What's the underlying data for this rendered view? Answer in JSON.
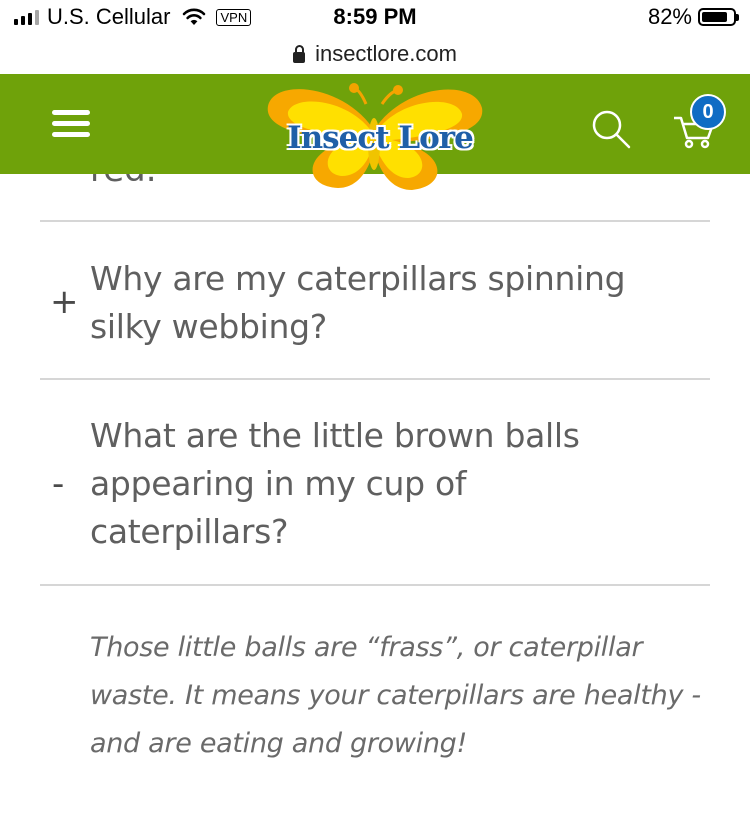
{
  "status_bar": {
    "carrier": "U.S. Cellular",
    "vpn": "VPN",
    "time": "8:59 PM",
    "battery_percent": "82%",
    "battery_level": 0.82
  },
  "browser": {
    "url": "insectlore.com"
  },
  "header": {
    "logo_text": "Insect Lore",
    "cart_count": "0",
    "colors": {
      "header_bg": "#6fa20a",
      "badge_bg": "#0f6cc4"
    }
  },
  "faq": {
    "partial_text": "red.",
    "items": [
      {
        "toggle": "+",
        "question": "Why are my caterpillars spinning silky webbing?"
      },
      {
        "toggle": "-",
        "question": "What are the little brown balls appearing in my cup of caterpillars?"
      }
    ],
    "answer": "Those little balls are “frass”, or caterpillar waste. It means your caterpillars are healthy - and are eating and growing!"
  },
  "icons": [
    "signal-icon",
    "wifi-icon",
    "battery-icon",
    "lock-icon",
    "menu-icon",
    "search-icon",
    "cart-icon"
  ]
}
